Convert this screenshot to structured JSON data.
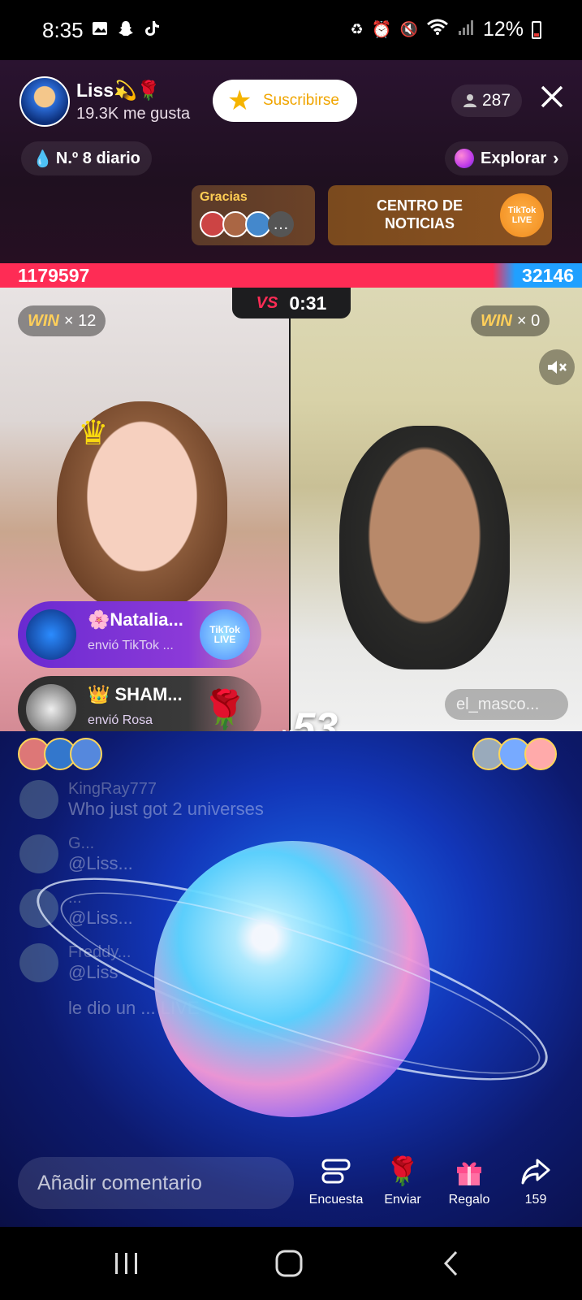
{
  "status_bar": {
    "time": "8:35",
    "battery": "12%",
    "icons_left": [
      "gallery-icon",
      "snapchat-icon",
      "tiktok-icon"
    ],
    "icons_right": [
      "battery-saver-icon",
      "alarm-icon",
      "mute-icon",
      "wifi-icon",
      "signal-icon"
    ]
  },
  "host": {
    "name": "Liss💫🌹",
    "likes": "19.3K me gusta",
    "subscribe_label": "Suscribirse",
    "viewers": "287"
  },
  "rank": {
    "label": "N.º 8 diario"
  },
  "explore": {
    "label": "Explorar"
  },
  "thanks": {
    "label": "Gracias",
    "more": "…"
  },
  "news": {
    "label": "CENTRO DE NOTICIAS",
    "logo_text": "TikTok LIVE"
  },
  "battle": {
    "left_score": "1179597",
    "right_score": "32146",
    "vs": "VS",
    "timer": "0:31",
    "left_win_word": "WIN",
    "left_win_count": "× 12",
    "right_win_word": "WIN",
    "right_win_count": "× 0",
    "opponent_name": "el_masco..."
  },
  "gifts": [
    {
      "name": "🌸Natalia...",
      "sub": "envió TikTok ...",
      "gift": "TikTok LIVE"
    },
    {
      "name": "👑 SHAM...",
      "sub": "envió Rosa",
      "gift": "rose"
    }
  ],
  "combo": {
    "x": "x",
    "count": "53"
  },
  "chat": [
    {
      "user": "KingRay777",
      "text": "Who just got 2 universes"
    },
    {
      "user": "G...",
      "text": "@Liss..."
    },
    {
      "user": "...",
      "text": "@Liss..."
    },
    {
      "user": "Freddy...",
      "text": "@Liss"
    },
    {
      "user": "",
      "text": "le dio un ... LIVE"
    }
  ],
  "bottom": {
    "comment_placeholder": "Añadir comentario",
    "poll_label": "Encuesta",
    "send_label": "Enviar",
    "gift_label": "Regalo",
    "share_label": "159"
  },
  "colors": {
    "accent_pink": "#fe2c55",
    "accent_blue": "#20a0ff",
    "win_gold": "#ffcf5a",
    "subscribe_orange": "#f0a500"
  }
}
